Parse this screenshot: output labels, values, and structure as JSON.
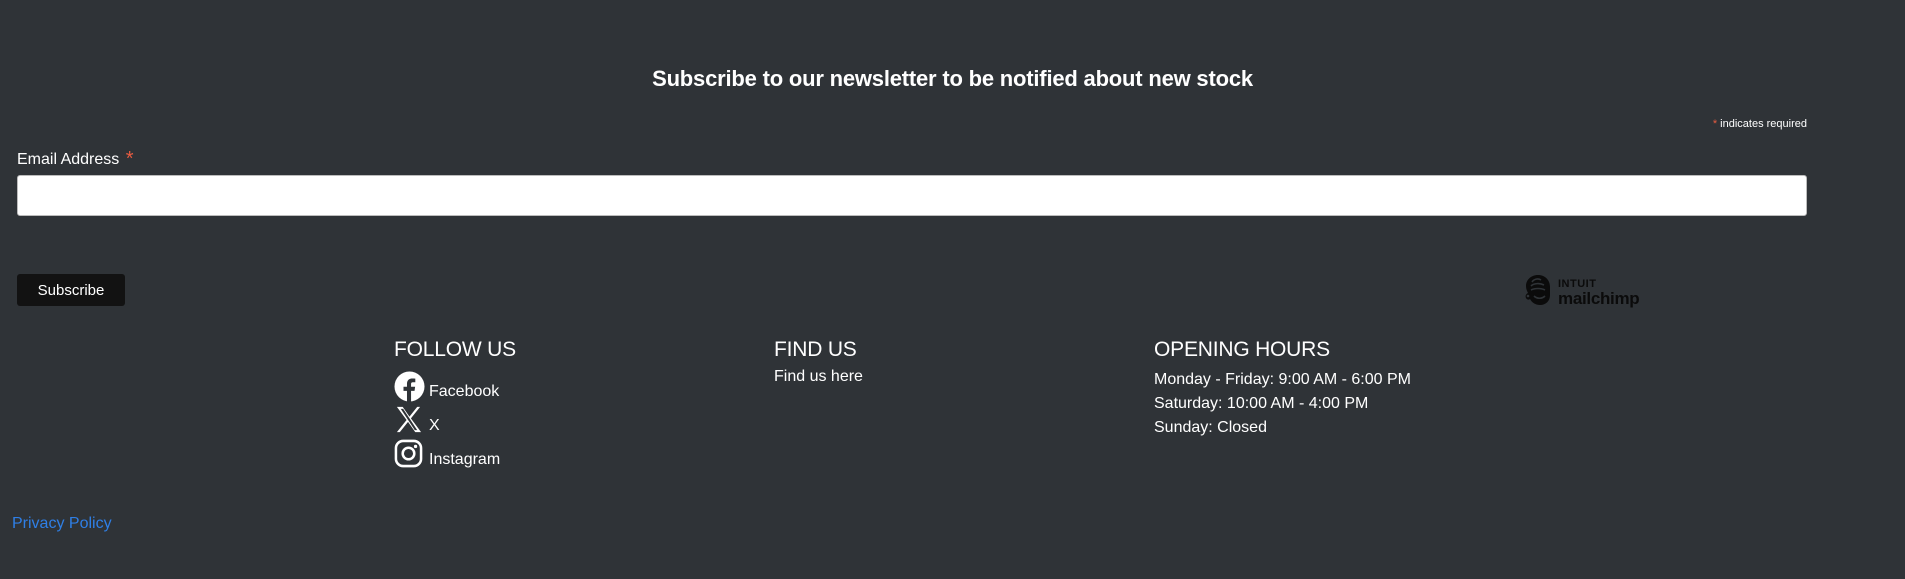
{
  "newsletter": {
    "title": "Subscribe to our newsletter to be notified about new stock",
    "required_asterisk": "*",
    "required_note": " indicates required",
    "email_label": "Email Address",
    "email_asterisk": "*",
    "email_value": "",
    "subscribe_label": "Subscribe"
  },
  "mailchimp": {
    "intuit": "INTUIT",
    "name": "mailchimp"
  },
  "footer": {
    "follow": {
      "heading": "FOLLOW US",
      "links": [
        {
          "label": "Facebook",
          "icon": "facebook-icon"
        },
        {
          "label": "X",
          "icon": "x-icon"
        },
        {
          "label": "Instagram",
          "icon": "instagram-icon"
        }
      ]
    },
    "find": {
      "heading": "FIND US",
      "link_label": "Find us here"
    },
    "hours": {
      "heading": "OPENING HOURS",
      "lines": [
        "Monday - Friday: 9:00 AM - 6:00 PM",
        "Saturday: 10:00 AM - 4:00 PM",
        "Sunday: Closed"
      ]
    }
  },
  "privacy_label": "Privacy Policy",
  "colors": {
    "background": "#2f3337",
    "accent_required": "#e85c41",
    "link": "#2f7fe6",
    "button": "#121212"
  }
}
